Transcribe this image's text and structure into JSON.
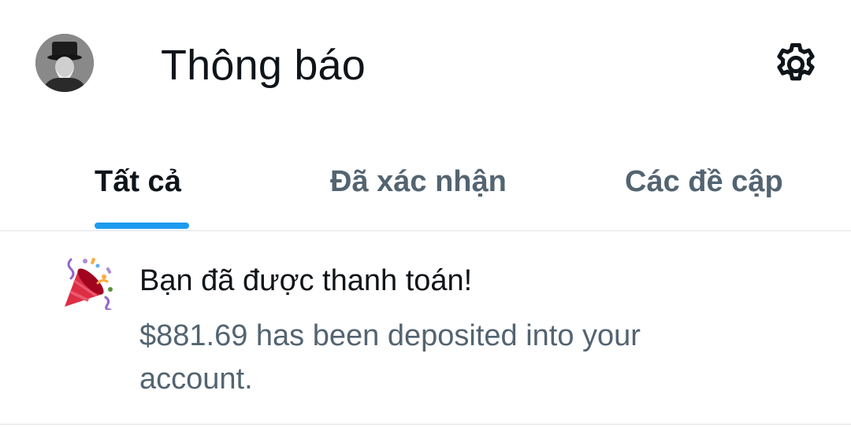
{
  "header": {
    "title": "Thông báo",
    "avatar_icon": "user-avatar-photo",
    "settings_icon": "gear-icon"
  },
  "tabs": [
    {
      "label": "Tất cả",
      "active": true
    },
    {
      "label": "Đã xác nhận",
      "active": false
    },
    {
      "label": "Các đề cập",
      "active": false
    }
  ],
  "notifications": [
    {
      "icon": "party-popper-icon",
      "title": "Bạn đã được thanh toán!",
      "body": "$881.69 has been deposited into your account."
    }
  ],
  "colors": {
    "accent": "#1d9bf0",
    "text_primary": "#0f1419",
    "text_secondary": "#536471",
    "divider": "#dfe4e8"
  }
}
